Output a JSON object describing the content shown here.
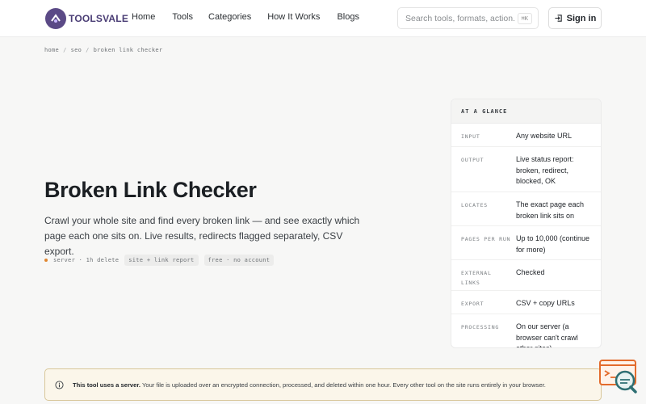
{
  "brand": {
    "name": "TOOLSVALE"
  },
  "nav": {
    "items": [
      {
        "label": "Home"
      },
      {
        "label": "Tools"
      },
      {
        "label": "Categories"
      },
      {
        "label": "How It Works"
      },
      {
        "label": "Blogs"
      }
    ]
  },
  "search": {
    "placeholder": "Search tools, formats, action...",
    "shortcut": "⌘K"
  },
  "header": {
    "signin_label": "Sign in"
  },
  "breadcrumb": {
    "items": [
      "home",
      "seo",
      "broken link checker"
    ],
    "separator": "/"
  },
  "hero": {
    "title": "Broken Link Checker",
    "description": "Crawl your whole site and find every broken link — and see exactly which page each one sits on. Live results, redirects flagged separately, CSV export.",
    "meta": "server · 1h delete",
    "chips": [
      "site + link report",
      "free · no account"
    ]
  },
  "glance": {
    "heading": "AT A GLANCE",
    "rows": [
      {
        "key": "INPUT",
        "value": "Any website URL"
      },
      {
        "key": "OUTPUT",
        "value": "Live status report: broken, redirect, blocked, OK"
      },
      {
        "key": "LOCATES",
        "value": "The exact page each broken link sits on"
      },
      {
        "key": "PAGES PER RUN",
        "value": "Up to 10,000 (continue for more)"
      },
      {
        "key": "EXTERNAL LINKS",
        "value": "Checked"
      },
      {
        "key": "EXPORT",
        "value": "CSV + copy URLs"
      },
      {
        "key": "PROCESSING",
        "value": "On our server (a browser can't crawl other sites)"
      }
    ]
  },
  "notice": {
    "strong": "This tool uses a server.",
    "text": " Your file is uploaded over an encrypted connection, processed, and deleted within one hour. Every other tool on the site runs entirely in your browser."
  },
  "colors": {
    "accent": "#5b4a86",
    "notice_border": "#d8c79a",
    "chat_orange": "#e36b2c",
    "chat_teal": "#2e6f73"
  }
}
